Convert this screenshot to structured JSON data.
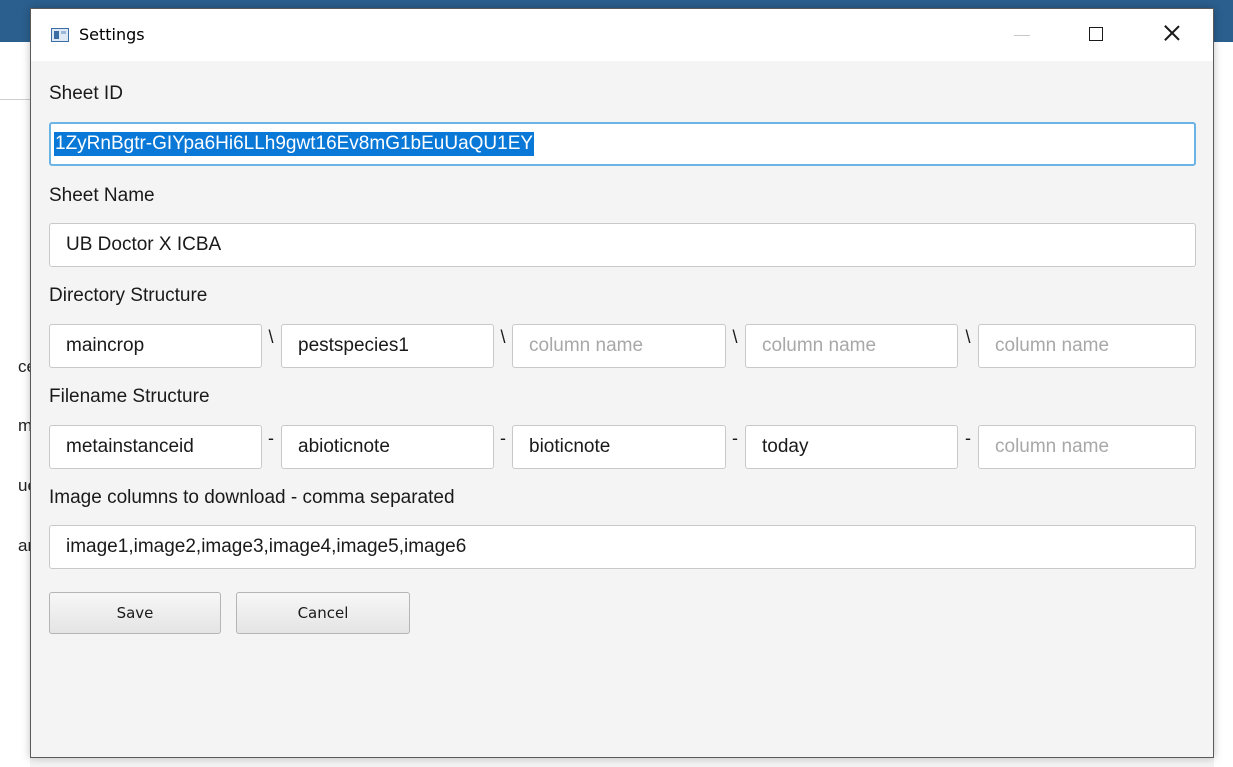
{
  "window": {
    "title": "Settings"
  },
  "fields": {
    "sheet_id": {
      "label": "Sheet ID",
      "value": "1ZyRnBgtr-GIYpa6Hi6LLh9gwt16Ev8mG1bEuUaQU1EY"
    },
    "sheet_name": {
      "label": "Sheet Name",
      "value": "UB Doctor X ICBA"
    },
    "directory_structure": {
      "label": "Directory Structure",
      "separator": "\\",
      "parts": [
        {
          "value": "maincrop",
          "placeholder": ""
        },
        {
          "value": "pestspecies1",
          "placeholder": ""
        },
        {
          "value": "",
          "placeholder": "column name"
        },
        {
          "value": "",
          "placeholder": "column name"
        },
        {
          "value": "",
          "placeholder": "column name"
        }
      ]
    },
    "filename_structure": {
      "label": "Filename Structure",
      "separator": "-",
      "parts": [
        {
          "value": "metainstanceid",
          "placeholder": ""
        },
        {
          "value": "abioticnote",
          "placeholder": ""
        },
        {
          "value": "bioticnote",
          "placeholder": ""
        },
        {
          "value": "today",
          "placeholder": ""
        },
        {
          "value": "",
          "placeholder": "column name"
        }
      ]
    },
    "image_columns": {
      "label": "Image columns to download - comma separated",
      "value": "image1,image2,image3,image4,image5,image6"
    }
  },
  "buttons": {
    "save": "Save",
    "cancel": "Cancel"
  },
  "background_fragments": [
    "ce",
    "m",
    "ue",
    "an"
  ]
}
